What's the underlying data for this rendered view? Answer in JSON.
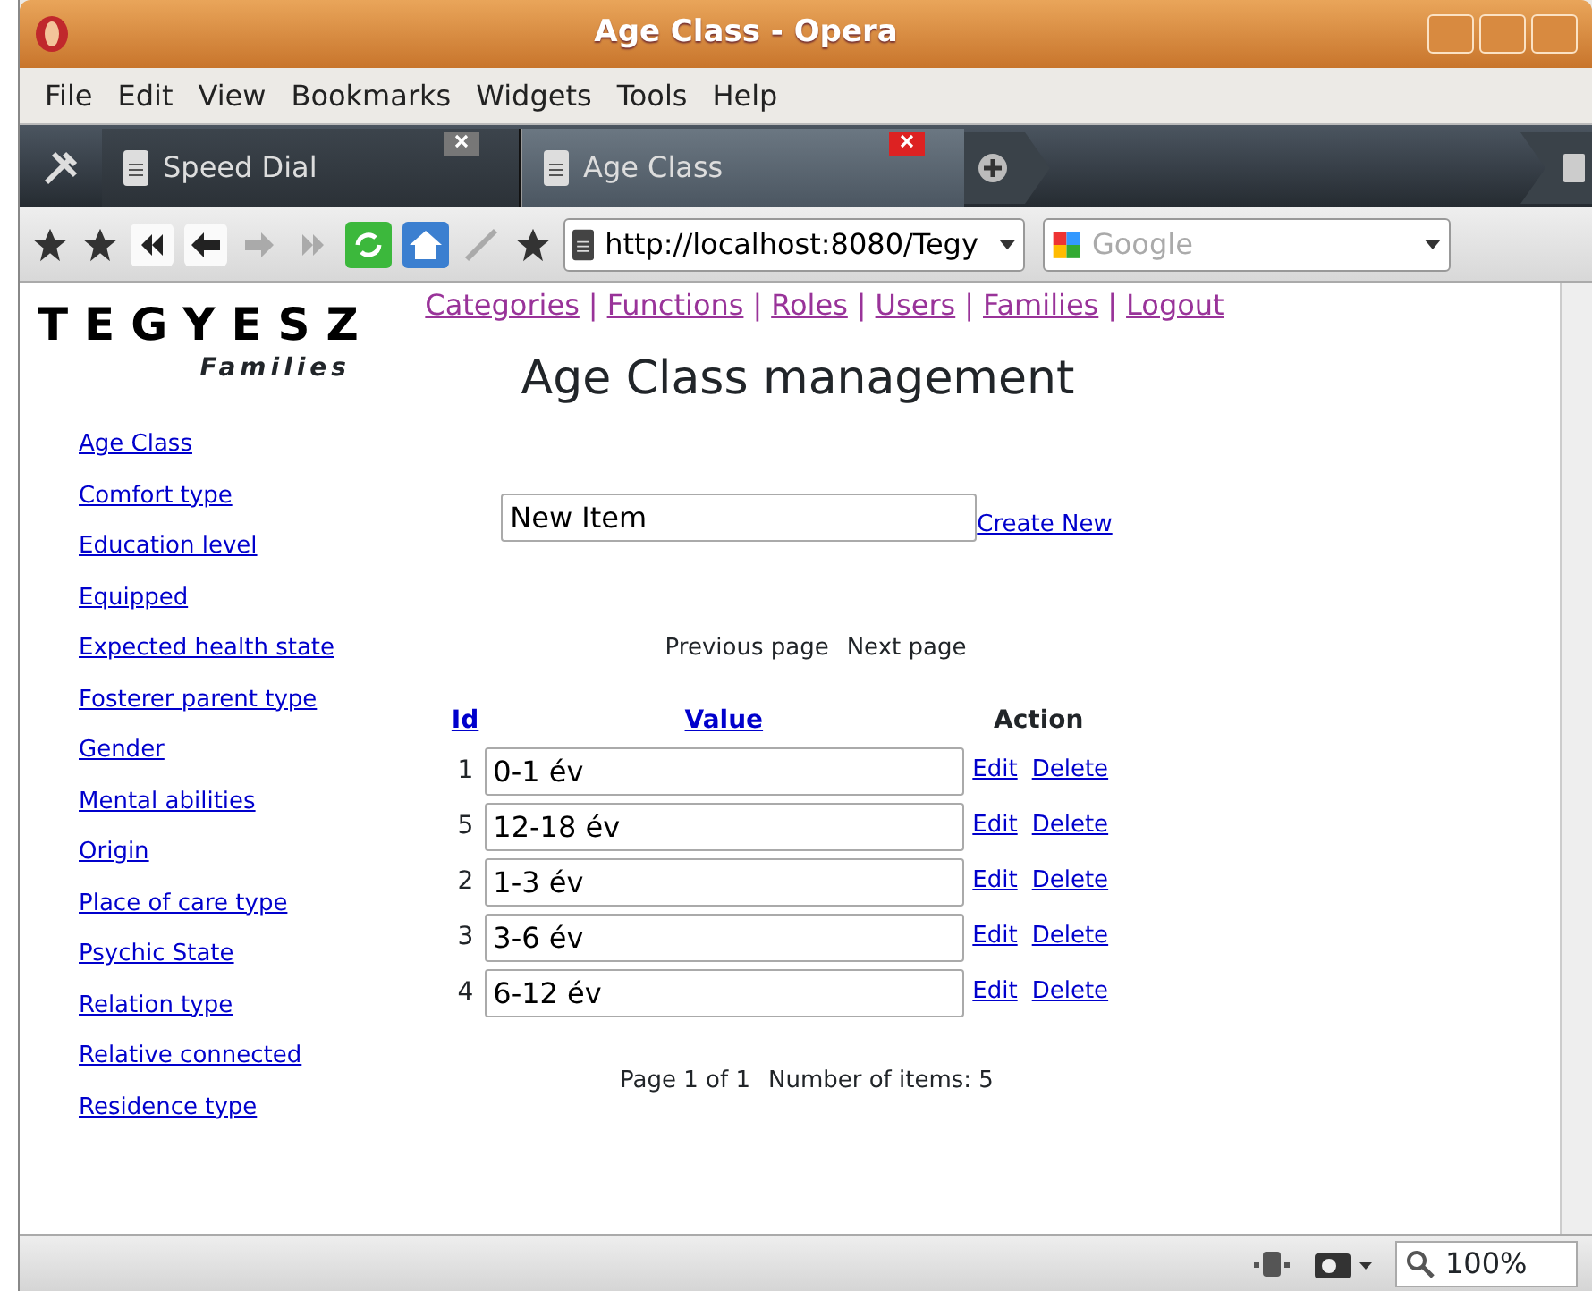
{
  "window": {
    "title": "Age Class - Opera"
  },
  "menu": [
    {
      "label": "File"
    },
    {
      "label": "Edit"
    },
    {
      "label": "View"
    },
    {
      "label": "Bookmarks"
    },
    {
      "label": "Widgets"
    },
    {
      "label": "Tools"
    },
    {
      "label": "Help"
    }
  ],
  "tabs": [
    {
      "label": "Speed Dial",
      "selected": false
    },
    {
      "label": "Age Class",
      "selected": true
    }
  ],
  "address": {
    "value": "http://localhost:8080/Tegy"
  },
  "search": {
    "placeholder": "Google"
  },
  "nav": {
    "separator": "|",
    "links": [
      "Categories",
      "Functions",
      "Roles",
      "Users",
      "Families",
      "Logout"
    ]
  },
  "logo": {
    "title": "TEGYESZ",
    "subtitle": "Families"
  },
  "sidebar": {
    "items": [
      "Age Class",
      "Comfort type",
      "Education level",
      "Equipped",
      "Expected health state",
      "Fosterer parent type",
      "Gender",
      "Mental abilities",
      "Origin",
      "Place of care type",
      "Psychic State",
      "Relation type",
      "Relative connected",
      "Residence type"
    ]
  },
  "heading": "Age Class management",
  "new_item": {
    "value": "New Item"
  },
  "create_link": "Create New",
  "pager": {
    "previous": "Previous page",
    "next": "Next page"
  },
  "table": {
    "columns": [
      "Id",
      "Value",
      "Action"
    ],
    "rows": [
      {
        "id": "1",
        "value": "0-1 év",
        "actions": [
          "Edit",
          "Delete"
        ]
      },
      {
        "id": "5",
        "value": "12-18 év",
        "actions": [
          "Edit",
          "Delete"
        ]
      },
      {
        "id": "2",
        "value": "1-3 év",
        "actions": [
          "Edit",
          "Delete"
        ]
      },
      {
        "id": "3",
        "value": "3-6 év",
        "actions": [
          "Edit",
          "Delete"
        ]
      },
      {
        "id": "4",
        "value": "6-12 év",
        "actions": [
          "Edit",
          "Delete"
        ]
      }
    ]
  },
  "footer": {
    "page": "Page 1 of 1",
    "count": "Number of items: 5"
  },
  "status_bar": {
    "zoom": "100%"
  }
}
